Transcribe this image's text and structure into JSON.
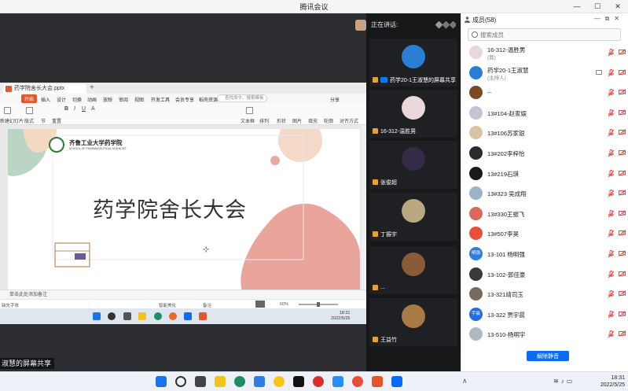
{
  "window": {
    "title": "腾讯会议"
  },
  "speaking": {
    "label": "正在讲话:"
  },
  "tiles": [
    {
      "name": "药学20-1王淑慧的屏幕共享",
      "sharing": true,
      "avatar_color": "#2a7fd4"
    },
    {
      "name": "16-312-温胜男",
      "sharing": false,
      "avatar_color": "#e9d7d9"
    },
    {
      "name": "张俊超",
      "sharing": false,
      "avatar_color": "#352a48"
    },
    {
      "name": "丁振宇",
      "sharing": false,
      "avatar_color": "#b9a77f"
    },
    {
      "name": "...",
      "sharing": false,
      "avatar_color": "#8a5b37"
    },
    {
      "name": "王益竹",
      "sharing": false,
      "avatar_color": "#a87a46"
    }
  ],
  "ppt": {
    "tab_title": "药学院舍长大会.pptx",
    "menu": [
      "开始",
      "插入",
      "设计",
      "切换",
      "动画",
      "放映",
      "审阅",
      "视图",
      "开发工具",
      "会员专享",
      "稻壳资源"
    ],
    "search_placeholder": "查找命令、搜索模板",
    "share_label": "分享",
    "ribbon": [
      "新建幻灯片",
      "版式",
      "节",
      "重置",
      "文本框",
      "排列",
      "形状",
      "图片",
      "填充",
      "轮廓",
      "对齐方式",
      "文本框",
      "艺术字"
    ],
    "slide_title": "药学院舍长大会",
    "school_name": "齐鲁工业大学药学院",
    "school_en": "SCHOOL OF PHARMACEUTICAL SCIENCES",
    "notes_placeholder": "单击此处添加备注",
    "status_left": "缺失字体",
    "status_notes": "备注",
    "status_zoom": "60%",
    "status_assist": "智能美化"
  },
  "inner_clock": {
    "time": "18:31",
    "date": "2022/5/25"
  },
  "share_label": "淑慧的屏幕共享",
  "panel": {
    "title": "成员(58)",
    "search_placeholder": "搜索成员",
    "members": [
      {
        "name": "16-312-温胜男",
        "role": "(我)",
        "avatar_color": "#e9d7d9",
        "muted": true
      },
      {
        "name": "药学20-1王淑慧",
        "role": "(主持人)",
        "avatar_color": "#2a7fd4",
        "muted": true,
        "sharing": true
      },
      {
        "name": "--",
        "role": "",
        "avatar_color": "#7a4a22",
        "muted": true
      },
      {
        "name": "13#104-赵家娱",
        "role": "",
        "avatar_color": "#c0c7d2",
        "muted": true
      },
      {
        "name": "13#106苏家银",
        "role": "",
        "avatar_color": "#d8c4a2",
        "muted": true
      },
      {
        "name": "13#202李梓怡",
        "role": "",
        "avatar_color": "#2b2b2b",
        "muted": true
      },
      {
        "name": "13#219石琪",
        "role": "",
        "avatar_color": "#1a1a1a",
        "muted": true
      },
      {
        "name": "13#323 吴成翔",
        "role": "",
        "avatar_color": "#9fb3c8",
        "muted": true
      },
      {
        "name": "13#330王振飞",
        "role": "",
        "avatar_color": "#d76a5a",
        "muted": true
      },
      {
        "name": "13#507李昊",
        "role": "",
        "avatar_color": "#e84e3a",
        "muted": true
      },
      {
        "name": "13-101 杨明强",
        "role": "",
        "avatar_color": "#2f7de0",
        "muted": true
      },
      {
        "name": "13-102-郭佳豪",
        "role": "",
        "avatar_color": "#3a3a3a",
        "muted": true
      },
      {
        "name": "13-321靖司玉",
        "role": "",
        "avatar_color": "#7a6a5a",
        "muted": true
      },
      {
        "name": "13-322 贾宇晨",
        "role": "",
        "avatar_color": "#1e6ee8",
        "muted": true
      },
      {
        "name": "13-510-杨明宇",
        "role": "",
        "avatar_color": "#b0b8c0",
        "muted": true
      }
    ],
    "avatar_texts": {
      "10": "明强",
      "13": "宇晨"
    },
    "unmute_label": "解除静音"
  },
  "taskbar": {
    "time": "18:31",
    "date": "2022/5/25"
  }
}
